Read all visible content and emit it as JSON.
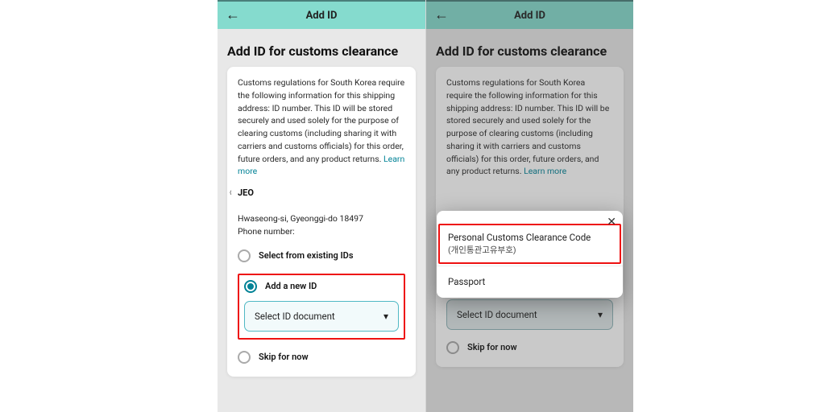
{
  "topbar": {
    "title": "Add ID"
  },
  "page": {
    "title": "Add ID for customs clearance"
  },
  "info": {
    "text": "Customs regulations for South Korea require the following information for this shipping address: ID number. This ID will be stored securely and used solely for the purpose of clearing customs (including sharing it with carriers and customs officials) for this order, future orders, and any product returns.",
    "learn_more": "Learn more"
  },
  "recipient": {
    "name": "JEO",
    "address_line": "Hwaseong-si, Gyeonggi-do 18497",
    "phone_label": "Phone number:"
  },
  "options": {
    "existing": "Select from existing IDs",
    "add_new": "Add a new ID",
    "skip": "Skip for now"
  },
  "select": {
    "placeholder": "Select ID document"
  },
  "popup": {
    "options": [
      {
        "label": "Personal Customs Clearance Code",
        "sub": "(개인통관고유부호)"
      },
      {
        "label": "Passport"
      }
    ]
  },
  "glyphs": {
    "back": "←",
    "close": "✕",
    "chev_down": "▾",
    "chev_left": "‹"
  }
}
